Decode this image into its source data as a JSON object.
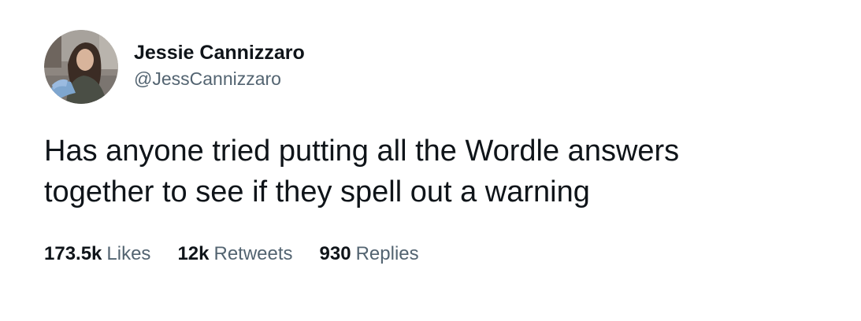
{
  "author": {
    "display_name": "Jessie Cannizzaro",
    "handle": "@JessCannizzaro",
    "avatar_icon": "profile-photo"
  },
  "tweet": {
    "text": "Has anyone tried putting all the Wordle answers\ntogether to see if they spell out a warning"
  },
  "stats": {
    "likes_count": "173.5k",
    "likes_label": "Likes",
    "retweets_count": "12k",
    "retweets_label": "Retweets",
    "replies_count": "930",
    "replies_label": "Replies"
  },
  "colors": {
    "text_primary": "#0f1419",
    "text_secondary": "#536471",
    "background": "#ffffff"
  }
}
